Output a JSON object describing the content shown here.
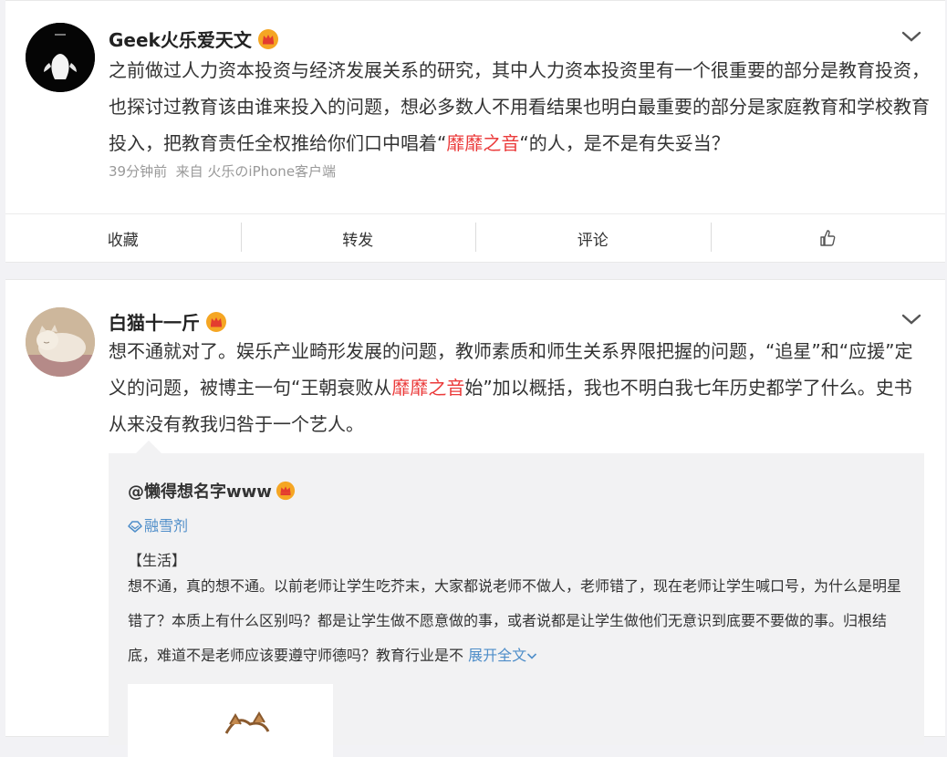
{
  "posts": [
    {
      "user_name": "Geek火乐爱天文",
      "text_parts": [
        "之前做过人力资本投资与经济发展关系的研究，其中人力资本投资里有一个很重要的部分是教育投资，也探讨过教育该由谁来投入的问题，想必多数人不用看结果也明白最重要的部分是家庭教育和学校教育投入，把教育责任全权推给你们口中唱着“",
        "靡靡之音",
        "“的人，是不是有失妥当？"
      ],
      "time": "39分钟前",
      "source": "来自 火乐のiPhone客户端",
      "actions": {
        "favorite": "收藏",
        "repost": "转发",
        "comment": "评论"
      }
    },
    {
      "user_name": "白猫十一斤",
      "text_parts": [
        "想不通就对了。娱乐产业畸形发展的问题，教师素质和师生关系界限把握的问题，“追星”和“应援”定义的问题，被博主一句“王朝衰败从",
        "靡靡之音",
        "始”加以概括，我也不明白我七年历史都学了什么。史书从来没有教我归咎于一个艺人。"
      ],
      "repost": {
        "user_name": "@懒得想名字www",
        "tag": "融雪剂",
        "category": "【生活】",
        "text": "想不通，真的想不通。以前老师让学生吃芥末，大家都说老师不做人，老师错了，现在老师让学生喊口号，为什么是明星错了？本质上有什么区别吗？都是让学生做不愿意做的事，或者说都是让学生做他们无意识到底要不要做的事。归根结底，难道不是老师应该要遵守师德吗？教育行业是不 ",
        "expand": "展开全文"
      }
    }
  ],
  "colors": {
    "highlight": "#eb3b3b",
    "link": "#4f8ec9",
    "meta": "#999999",
    "crown": "#f5a623"
  },
  "icons": [
    "crown-icon",
    "chevron-down-icon",
    "thumbs-up-icon",
    "tag-icon"
  ]
}
